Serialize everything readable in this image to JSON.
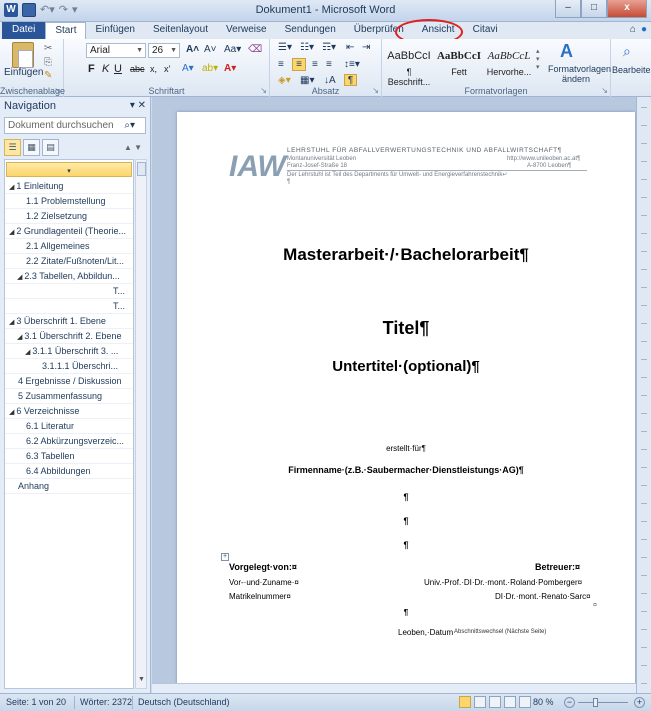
{
  "window": {
    "title": "Dokument1 - Microsoft Word",
    "controls": [
      "–",
      "□",
      "x"
    ]
  },
  "tabs": [
    "Datei",
    "Start",
    "Einfügen",
    "Seitenlayout",
    "Verweise",
    "Sendungen",
    "Überprüfen",
    "Ansicht",
    "Citavi"
  ],
  "ribbon": {
    "clipboard": {
      "paste": "Einfügen",
      "label": "Zwischenablage"
    },
    "font": {
      "name": "Arial",
      "size": "26",
      "label": "Schriftart",
      "bold": "F",
      "italic": "K",
      "underline": "U",
      "strike": "abc",
      "sub": "x,",
      "sup": "x'"
    },
    "paragraph": {
      "label": "Absatz"
    },
    "styles": {
      "label": "Formatvorlagen",
      "items": [
        {
          "sample": "AaBbCcI",
          "name": "¶ Beschrift..."
        },
        {
          "sample": "AaBbCcI",
          "name": "Fett"
        },
        {
          "sample": "AaBbCcL",
          "name": "Hervorhe..."
        }
      ],
      "change": "Formatvorlagen ändern"
    },
    "editing": {
      "label": "Bearbeiten"
    }
  },
  "nav": {
    "title": "Navigation",
    "search_placeholder": "Dokument durchsuchen",
    "items": [
      {
        "text": "",
        "level": 0,
        "top": true
      },
      {
        "text": "1 Einleitung",
        "level": 0,
        "expander": true
      },
      {
        "text": "1.1 Problemstellung",
        "level": 1
      },
      {
        "text": "1.2 Zielsetzung",
        "level": 1
      },
      {
        "text": "2 Grundlagenteil (Theorie...",
        "level": 0,
        "expander": true
      },
      {
        "text": "2.1 Allgemeines",
        "level": 1
      },
      {
        "text": "2.2 Zitate/Fußnoten/Lit...",
        "level": 1
      },
      {
        "text": "2.3 Tabellen, Abbildun...",
        "level": 1,
        "expander": true
      },
      {
        "text": "T...",
        "level": 2,
        "right": true
      },
      {
        "text": "T...",
        "level": 2,
        "right": true
      },
      {
        "text": "3 Überschrift 1. Ebene",
        "level": 0,
        "expander": true
      },
      {
        "text": "3.1 Überschrift 2. Ebene",
        "level": 1,
        "expander": true
      },
      {
        "text": "3.1.1 Überschrift 3. ...",
        "level": 2,
        "expander": true
      },
      {
        "text": "3.1.1.1 Überschri...",
        "level": 3
      },
      {
        "text": "4 Ergebnisse / Diskussion",
        "level": 0
      },
      {
        "text": "5 Zusammenfassung",
        "level": 0
      },
      {
        "text": "6 Verzeichnisse",
        "level": 0,
        "expander": true
      },
      {
        "text": "6.1 Literatur",
        "level": 1
      },
      {
        "text": "6.2 Abkürzungsverzeic...",
        "level": 1
      },
      {
        "text": "6.3 Tabellen",
        "level": 1
      },
      {
        "text": "6.4 Abbildungen",
        "level": 1
      },
      {
        "text": "Anhang",
        "level": 0
      }
    ]
  },
  "page": {
    "header_title": "LEHRSTUHL FÜR ABFALLVERWERTUNGSTECHNIK UND ABFALLWIRTSCHAFT¶",
    "header_line2_left": "Montanuniversität Leoben",
    "header_line2_right": "http://www.unileoben.ac.at¶",
    "header_line3_left": "Franz-Josef-Straße 18",
    "header_line3_right": "A-8700 Leoben¶",
    "header_line4": "Der Lehrstuhl ist Teil des Departments für Umwelt- und Energieverfahrenstechnik↵",
    "header_pilcrow": "¶",
    "main_title": "Masterarbeit·/·Bachelorarbeit¶",
    "title": "Titel¶",
    "subtitle": "Untertitel·(optional)¶",
    "created_for": "erstellt·für¶",
    "company": "Firmenname·(z.B.·Saubermacher·Dienstleistungs·AG)¶",
    "pilcrow": "¶",
    "submitted_by": "Vorgelegt·von:¤",
    "supervisor": "Betreuer:¤",
    "name_field": "Vor-·und·Zuname·¤",
    "supervisor1": "Univ.-Prof.·DI·Dr.·mont.·Roland·Pomberger¤",
    "matrikel": "Matrikelnummer¤",
    "supervisor2": "DI·Dr.·mont.·Renato·Sarc¤",
    "cell_marker": "¤",
    "location": "Leoben,·Datum",
    "section_break": "Abschnittswechsel (Nächste Seite)"
  },
  "status": {
    "page": "Seite: 1 von 20",
    "words": "Wörter: 2372",
    "language": "Deutsch (Deutschland)",
    "zoom": "80 %",
    "zoom_minus": "−",
    "zoom_plus": "+"
  }
}
